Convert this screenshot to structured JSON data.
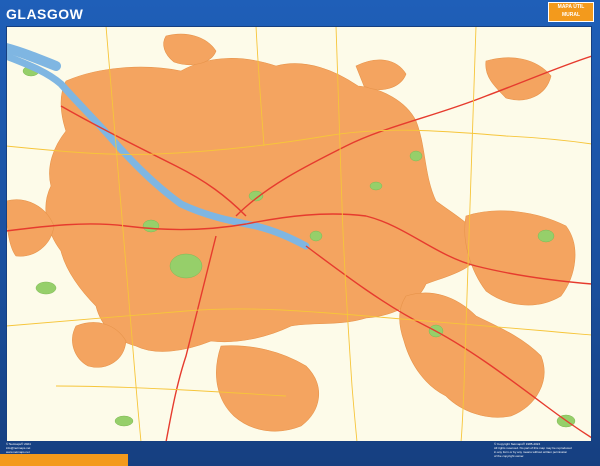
{
  "map": {
    "title": "GLASGOW",
    "badge": [
      "MAPA ÚTIL",
      "MURAL"
    ],
    "colors": {
      "frame": "#1f5fb8",
      "badge": "#f39a1c",
      "urban": "#f4a460",
      "urban_dark": "#e7944b",
      "land": "#fdfbe9",
      "park": "#96cf6a",
      "water": "#7fb6e2",
      "road_main": "#e63b2e",
      "road_secondary": "#f6c53a"
    }
  },
  "footer": {
    "left_lines": [
      "© Netmaps® 2024",
      "info@netmaps.net",
      "www.netmaps.net"
    ],
    "right_lines": [
      "© Copyright Netmaps® 1985-2024",
      "All rights reserved. No part of this map may be reproduced",
      "in any form or by any means without written permission",
      "of the copyright owner."
    ]
  }
}
